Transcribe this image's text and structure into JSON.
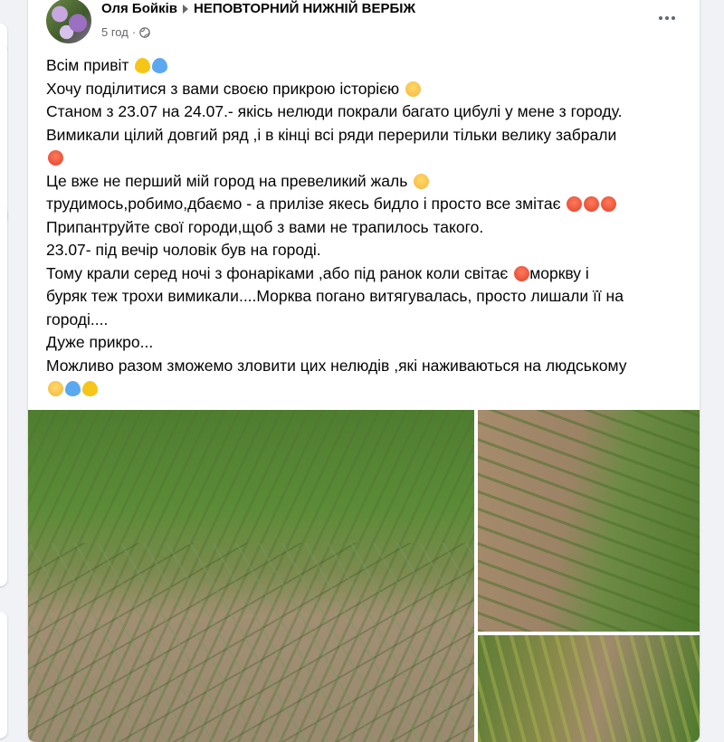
{
  "post": {
    "author": "Оля Бойків",
    "group": "НЕПОВТОРНИЙ НИЖНІЙ ВЕРБІЖ",
    "time": "5 год",
    "privacy_icon": "globe-icon",
    "more_icon": "more-options-icon",
    "lines": [
      {
        "text": "Всім привіт",
        "emoji": [
          "yellow-heart",
          "blue-heart"
        ]
      },
      {
        "text": "Хочу поділитися з вами своєю прикрою історією",
        "emoji": [
          "sad-face"
        ]
      },
      {
        "text": "Станом з 23.07 на 24.07.- якісь нелюди покрали багато цибулі у мене з городу.",
        "emoji": []
      },
      {
        "text": "Вимикали цілий довгий ряд ,і в кінці всі ряди перерили тільки велику забрали",
        "emoji": []
      },
      {
        "text": "",
        "emoji": [
          "angry-face"
        ]
      },
      {
        "text": "Це вже не перший мій город на превеликий жаль",
        "emoji": [
          "sad-face"
        ]
      },
      {
        "text": "трудимось,робимо,дбаємо - а прилізе якесь бидло і просто все змітає",
        "emoji": [
          "angry-face",
          "angry-face",
          "angry-face"
        ]
      },
      {
        "text": "Припантруйте свої городи,щоб з вами не трапилось такого.",
        "emoji": []
      },
      {
        "text": "23.07- під вечір чоловік був на городі.",
        "emoji": []
      },
      {
        "text": "Тому крали серед ночі з фонаріками ,або під ранок коли світає",
        "emoji": [
          "angry-face"
        ],
        "after": "моркву і"
      },
      {
        "text": "буряк теж трохи вимикали....Морква погано витягувалась, просто лишали її на",
        "emoji": []
      },
      {
        "text": "городі....",
        "emoji": []
      },
      {
        "text": "Дуже прикро...",
        "emoji": []
      },
      {
        "text": "Можливо разом зможемо зловити цих нелюдів ,які наживаються на людському",
        "emoji": []
      },
      {
        "text": "",
        "emoji": [
          "sad-face",
          "blue-heart",
          "yellow-heart"
        ]
      }
    ],
    "photos": [
      {
        "name": "photo-onion-beds"
      },
      {
        "name": "photo-garden-rows"
      },
      {
        "name": "photo-garden-greens"
      }
    ]
  },
  "colors": {
    "background": "#f0f2f5",
    "card": "#ffffff",
    "text": "#050505",
    "meta": "#65676b"
  }
}
